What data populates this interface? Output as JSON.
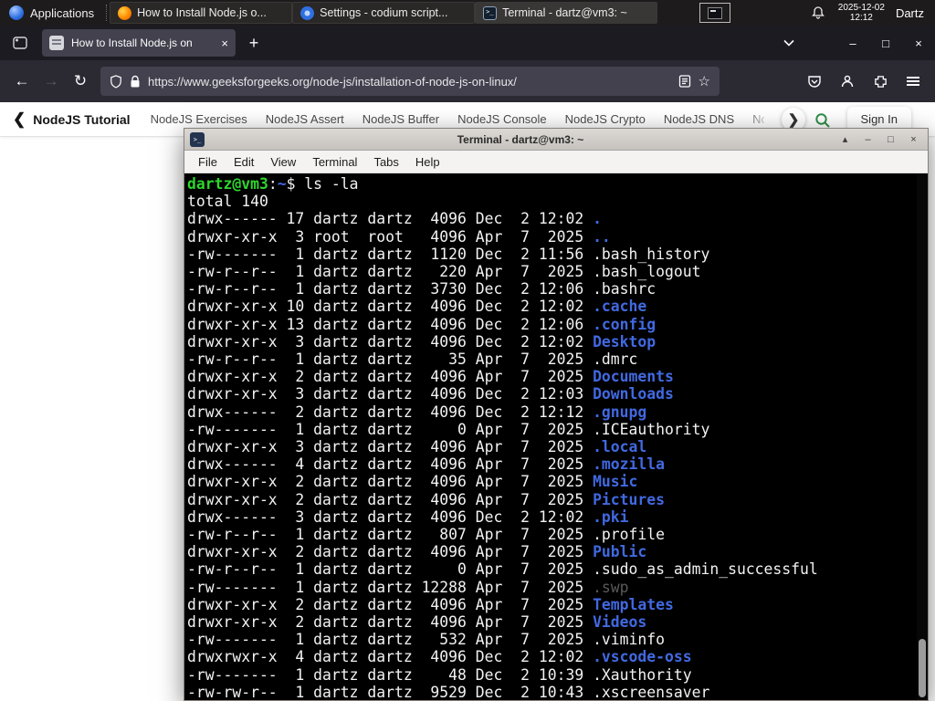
{
  "colors": {
    "term-green": "#2ed52e",
    "term-blue": "#4169e1",
    "term-dim": "#5a5a5a",
    "term-fg": "#f2f2f2",
    "gfg-green": "#2f8d46"
  },
  "icons": {
    "back": "←",
    "forward": "→",
    "reload": "↻",
    "star": "☆",
    "new_tab": "+",
    "close": "×",
    "minimize": "–",
    "maximize": "□",
    "shade": "▴",
    "chevron_left": "❮",
    "chevron_right": "❯",
    "tab_close": "×"
  },
  "panel": {
    "applications_label": "Applications",
    "tasks": [
      {
        "title": "How to Install Node.js o...",
        "icon": "firefox"
      },
      {
        "title": "Settings - codium script...",
        "icon": "settings"
      },
      {
        "title": "Terminal - dartz@vm3: ~",
        "icon": "terminal"
      }
    ],
    "clock_date": "2025-12-02",
    "clock_time": "12:12",
    "user_label": "Dartz"
  },
  "browser": {
    "tab_title": "How to Install Node.js on",
    "url": "https://www.geeksforgeeks.org/node-js/installation-of-node-js-on-linux/"
  },
  "site_nav": {
    "active_item": "NodeJS Tutorial",
    "items": [
      "NodeJS Exercises",
      "NodeJS Assert",
      "NodeJS Buffer",
      "NodeJS Console",
      "NodeJS Crypto",
      "NodeJS DNS",
      "NodeJS"
    ],
    "sign_in_label": "Sign In"
  },
  "terminal": {
    "title": "Terminal - dartz@vm3: ~",
    "menu": [
      "File",
      "Edit",
      "View",
      "Terminal",
      "Tabs",
      "Help"
    ],
    "lines": [
      {
        "segs": [
          {
            "t": "dartz@vm3",
            "c": "green"
          },
          {
            "t": ":",
            "c": "fg"
          },
          {
            "t": "~",
            "c": "blue"
          },
          {
            "t": "$ ls -la",
            "c": "fg"
          }
        ]
      },
      {
        "segs": [
          {
            "t": "total 140",
            "c": "fg"
          }
        ]
      },
      {
        "segs": [
          {
            "t": "drwx------ 17 dartz dartz  4096 Dec  2 12:02 ",
            "c": "fg"
          },
          {
            "t": ".",
            "c": "blue"
          }
        ]
      },
      {
        "segs": [
          {
            "t": "drwxr-xr-x  3 root  root   4096 Apr  7  2025 ",
            "c": "fg"
          },
          {
            "t": "..",
            "c": "blue"
          }
        ]
      },
      {
        "segs": [
          {
            "t": "-rw-------  1 dartz dartz  1120 Dec  2 11:56 ",
            "c": "fg"
          },
          {
            "t": ".bash_history",
            "c": "fg"
          }
        ]
      },
      {
        "segs": [
          {
            "t": "-rw-r--r--  1 dartz dartz   220 Apr  7  2025 ",
            "c": "fg"
          },
          {
            "t": ".bash_logout",
            "c": "fg"
          }
        ]
      },
      {
        "segs": [
          {
            "t": "-rw-r--r--  1 dartz dartz  3730 Dec  2 12:06 ",
            "c": "fg"
          },
          {
            "t": ".bashrc",
            "c": "fg"
          }
        ]
      },
      {
        "segs": [
          {
            "t": "drwxr-xr-x 10 dartz dartz  4096 Dec  2 12:02 ",
            "c": "fg"
          },
          {
            "t": ".cache",
            "c": "blue"
          }
        ]
      },
      {
        "segs": [
          {
            "t": "drwxr-xr-x 13 dartz dartz  4096 Dec  2 12:06 ",
            "c": "fg"
          },
          {
            "t": ".config",
            "c": "blue"
          }
        ]
      },
      {
        "segs": [
          {
            "t": "drwxr-xr-x  3 dartz dartz  4096 Dec  2 12:02 ",
            "c": "fg"
          },
          {
            "t": "Desktop",
            "c": "blue"
          }
        ]
      },
      {
        "segs": [
          {
            "t": "-rw-r--r--  1 dartz dartz    35 Apr  7  2025 ",
            "c": "fg"
          },
          {
            "t": ".dmrc",
            "c": "fg"
          }
        ]
      },
      {
        "segs": [
          {
            "t": "drwxr-xr-x  2 dartz dartz  4096 Apr  7  2025 ",
            "c": "fg"
          },
          {
            "t": "Documents",
            "c": "blue"
          }
        ]
      },
      {
        "segs": [
          {
            "t": "drwxr-xr-x  3 dartz dartz  4096 Dec  2 12:03 ",
            "c": "fg"
          },
          {
            "t": "Downloads",
            "c": "blue"
          }
        ]
      },
      {
        "segs": [
          {
            "t": "drwx------  2 dartz dartz  4096 Dec  2 12:12 ",
            "c": "fg"
          },
          {
            "t": ".gnupg",
            "c": "blue"
          }
        ]
      },
      {
        "segs": [
          {
            "t": "-rw-------  1 dartz dartz     0 Apr  7  2025 ",
            "c": "fg"
          },
          {
            "t": ".ICEauthority",
            "c": "fg"
          }
        ]
      },
      {
        "segs": [
          {
            "t": "drwxr-xr-x  3 dartz dartz  4096 Apr  7  2025 ",
            "c": "fg"
          },
          {
            "t": ".local",
            "c": "blue"
          }
        ]
      },
      {
        "segs": [
          {
            "t": "drwx------  4 dartz dartz  4096 Apr  7  2025 ",
            "c": "fg"
          },
          {
            "t": ".mozilla",
            "c": "blue"
          }
        ]
      },
      {
        "segs": [
          {
            "t": "drwxr-xr-x  2 dartz dartz  4096 Apr  7  2025 ",
            "c": "fg"
          },
          {
            "t": "Music",
            "c": "blue"
          }
        ]
      },
      {
        "segs": [
          {
            "t": "drwxr-xr-x  2 dartz dartz  4096 Apr  7  2025 ",
            "c": "fg"
          },
          {
            "t": "Pictures",
            "c": "blue"
          }
        ]
      },
      {
        "segs": [
          {
            "t": "drwx------  3 dartz dartz  4096 Dec  2 12:02 ",
            "c": "fg"
          },
          {
            "t": ".pki",
            "c": "blue"
          }
        ]
      },
      {
        "segs": [
          {
            "t": "-rw-r--r--  1 dartz dartz   807 Apr  7  2025 ",
            "c": "fg"
          },
          {
            "t": ".profile",
            "c": "fg"
          }
        ]
      },
      {
        "segs": [
          {
            "t": "drwxr-xr-x  2 dartz dartz  4096 Apr  7  2025 ",
            "c": "fg"
          },
          {
            "t": "Public",
            "c": "blue"
          }
        ]
      },
      {
        "segs": [
          {
            "t": "-rw-r--r--  1 dartz dartz     0 Apr  7  2025 ",
            "c": "fg"
          },
          {
            "t": ".sudo_as_admin_successful",
            "c": "fg"
          }
        ]
      },
      {
        "segs": [
          {
            "t": "-rw-------  1 dartz dartz 12288 Apr  7  2025 ",
            "c": "fg"
          },
          {
            "t": ".swp",
            "c": "dim"
          }
        ]
      },
      {
        "segs": [
          {
            "t": "drwxr-xr-x  2 dartz dartz  4096 Apr  7  2025 ",
            "c": "fg"
          },
          {
            "t": "Templates",
            "c": "blue"
          }
        ]
      },
      {
        "segs": [
          {
            "t": "drwxr-xr-x  2 dartz dartz  4096 Apr  7  2025 ",
            "c": "fg"
          },
          {
            "t": "Videos",
            "c": "blue"
          }
        ]
      },
      {
        "segs": [
          {
            "t": "-rw-------  1 dartz dartz   532 Apr  7  2025 ",
            "c": "fg"
          },
          {
            "t": ".viminfo",
            "c": "fg"
          }
        ]
      },
      {
        "segs": [
          {
            "t": "drwxrwxr-x  4 dartz dartz  4096 Dec  2 12:02 ",
            "c": "fg"
          },
          {
            "t": ".vscode-oss",
            "c": "blue"
          }
        ]
      },
      {
        "segs": [
          {
            "t": "-rw-------  1 dartz dartz    48 Dec  2 10:39 ",
            "c": "fg"
          },
          {
            "t": ".Xauthority",
            "c": "fg"
          }
        ]
      },
      {
        "segs": [
          {
            "t": "-rw-rw-r--  1 dartz dartz  9529 Dec  2 10:43 ",
            "c": "fg"
          },
          {
            "t": ".xscreensaver",
            "c": "fg"
          }
        ]
      }
    ]
  }
}
